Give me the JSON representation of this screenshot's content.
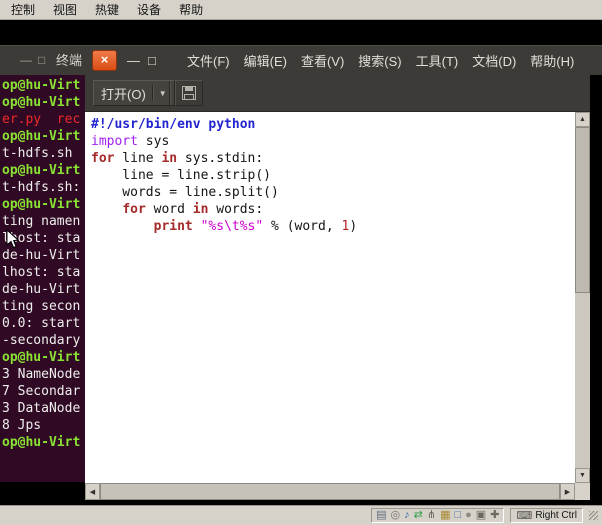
{
  "vm_menubar": {
    "items": [
      {
        "label": "控制"
      },
      {
        "label": "视图"
      },
      {
        "label": "热键"
      },
      {
        "label": "设备"
      },
      {
        "label": "帮助"
      }
    ]
  },
  "terminal": {
    "title": "终端",
    "min_glyph": "—",
    "max_glyph": "□",
    "lines": [
      {
        "text": "op@hu-Virt",
        "color": "green"
      },
      {
        "text": "op@hu-Virt",
        "color": "green"
      },
      {
        "text": "er.py  rec",
        "color": "red"
      },
      {
        "text": "op@hu-Virt",
        "color": "green"
      },
      {
        "text": "t-hdfs.sh",
        "color": "white"
      },
      {
        "text": "op@hu-Virt",
        "color": "green"
      },
      {
        "text": "t-hdfs.sh:",
        "color": "white"
      },
      {
        "text": "op@hu-Virt",
        "color": "green"
      },
      {
        "text": "ting namen",
        "color": "white"
      },
      {
        "text": "lhost: sta",
        "color": "white"
      },
      {
        "text": "de-hu-Virt",
        "color": "white"
      },
      {
        "text": "lhost: sta",
        "color": "white"
      },
      {
        "text": "de-hu-Virt",
        "color": "white"
      },
      {
        "text": "ting secon",
        "color": "white"
      },
      {
        "text": "0.0: start",
        "color": "white"
      },
      {
        "text": "-secondary",
        "color": "white"
      },
      {
        "text": "op@hu-Virt",
        "color": "green"
      },
      {
        "text": "3 NameNode",
        "color": "white"
      },
      {
        "text": "7 Secondar",
        "color": "white"
      },
      {
        "text": "3 DataNode",
        "color": "white"
      },
      {
        "text": "8 Jps",
        "color": "white"
      },
      {
        "text": "op@hu-Virt",
        "color": "green"
      }
    ]
  },
  "gedit": {
    "close_glyph": "×",
    "min_glyph": "—",
    "max_glyph": "□",
    "menus": [
      {
        "label": "文件(F)"
      },
      {
        "label": "编辑(E)"
      },
      {
        "label": "查看(V)"
      },
      {
        "label": "搜索(S)"
      },
      {
        "label": "工具(T)"
      },
      {
        "label": "文档(D)"
      },
      {
        "label": "帮助(H)"
      }
    ],
    "toolbar": {
      "open_label": "打开(O)",
      "caret": "▼"
    },
    "code_lines": [
      [
        {
          "t": "#!/usr/bin/env python",
          "s": "shebang"
        }
      ],
      [
        {
          "t": "import",
          "s": "import"
        },
        {
          "t": " sys",
          "s": "plain"
        }
      ],
      [
        {
          "t": "for",
          "s": "kw"
        },
        {
          "t": " line ",
          "s": "plain"
        },
        {
          "t": "in",
          "s": "kw"
        },
        {
          "t": " sys.stdin:",
          "s": "plain"
        }
      ],
      [
        {
          "t": "    line = line.strip()",
          "s": "plain"
        }
      ],
      [
        {
          "t": "    words = line.split()",
          "s": "plain"
        }
      ],
      [
        {
          "t": "    ",
          "s": "plain"
        },
        {
          "t": "for",
          "s": "kw"
        },
        {
          "t": " word ",
          "s": "plain"
        },
        {
          "t": "in",
          "s": "kw"
        },
        {
          "t": " words:",
          "s": "plain"
        }
      ],
      [
        {
          "t": "        ",
          "s": "plain"
        },
        {
          "t": "print",
          "s": "kw"
        },
        {
          "t": " ",
          "s": "plain"
        },
        {
          "t": "\"%s\\t%s\"",
          "s": "str"
        },
        {
          "t": " % (word, ",
          "s": "plain"
        },
        {
          "t": "1",
          "s": "num"
        },
        {
          "t": ")",
          "s": "plain"
        }
      ]
    ]
  },
  "scrollbars": {
    "up": "▲",
    "down": "▼",
    "left": "◀",
    "right": "▶"
  },
  "statusbar": {
    "host_key": "Right Ctrl",
    "keyboard_glyph": "⌨",
    "icons": [
      {
        "name": "hard-disk-icon",
        "glyph": "▤",
        "color": "#5d6d7e"
      },
      {
        "name": "optical-disk-icon",
        "glyph": "◎",
        "color": "#74716a"
      },
      {
        "name": "audio-icon",
        "glyph": "♪",
        "color": "#3a6ea5"
      },
      {
        "name": "network-icon",
        "glyph": "⇄",
        "color": "#2e9e44"
      },
      {
        "name": "usb-icon",
        "glyph": "⋔",
        "color": "#6d675f"
      },
      {
        "name": "shared-folder-icon",
        "glyph": "▦",
        "color": "#a98a2f"
      },
      {
        "name": "display-icon",
        "glyph": "□",
        "color": "#3a6ea5"
      },
      {
        "name": "recording-icon",
        "glyph": "●",
        "color": "#8d8a82"
      },
      {
        "name": "features-icon",
        "glyph": "▣",
        "color": "#6d675f"
      },
      {
        "name": "mouse-icon",
        "glyph": "✚",
        "color": "#6d675f"
      }
    ]
  },
  "colors": {
    "terminal_bg": "#300a24",
    "prompt_green": "#8ae234",
    "titlebar_bg": "#3c3b37",
    "close_button_orange": "#e1561e",
    "statusbar_bg": "#d6d2ca"
  }
}
